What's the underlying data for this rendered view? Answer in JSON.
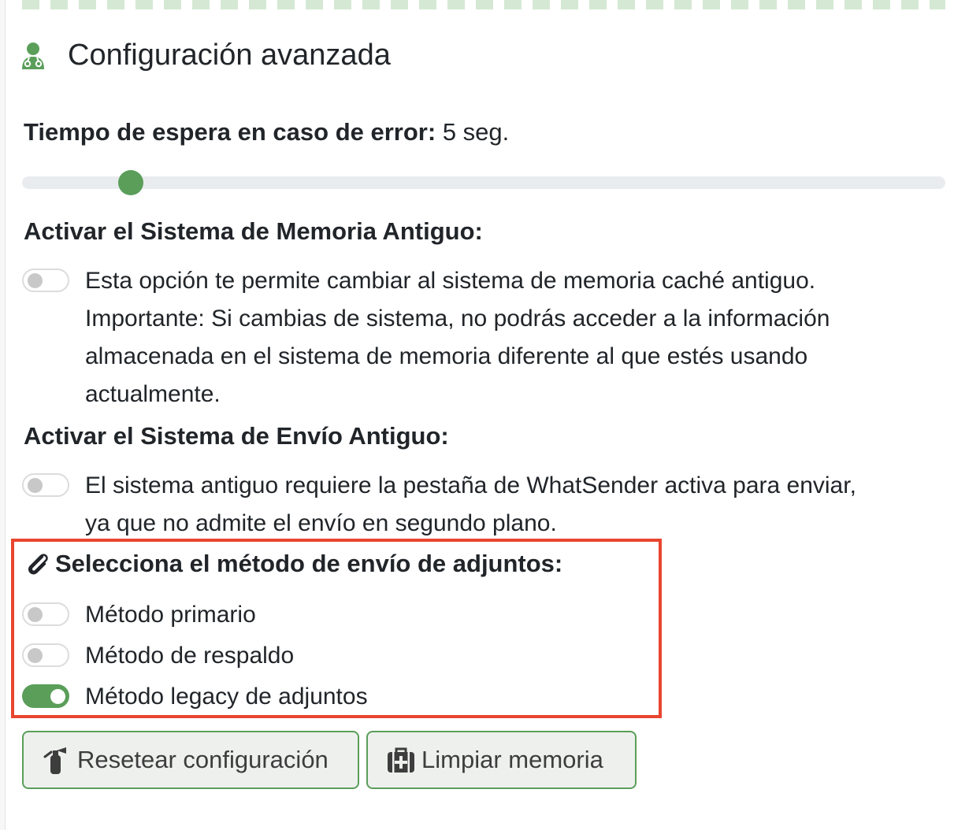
{
  "header": {
    "title": "Configuración avanzada",
    "icon": "user-md-icon"
  },
  "timeout": {
    "label": "Tiempo de espera en caso de error:",
    "value": "5 seg.",
    "slider_fraction": 0.118
  },
  "memory_system": {
    "title": "Activar el Sistema de Memoria Antiguo:",
    "enabled": false,
    "description_lines": [
      "Esta opción te permite cambiar al sistema de memoria caché antiguo.",
      "Importante: Si cambias de sistema, no podrás acceder a la información",
      "almacenada en el sistema de memoria diferente al que estés usando",
      "actualmente."
    ]
  },
  "send_system": {
    "title": "Activar el Sistema de Envío Antiguo:",
    "enabled": false,
    "description_lines": [
      "El sistema antiguo requiere la pestaña de WhatSender activa para enviar,",
      "ya que no admite el envío en segundo plano."
    ]
  },
  "attachments": {
    "title": "Selecciona el método de envío de adjuntos:",
    "icon": "paperclip-icon",
    "options": [
      {
        "label": "Método primario",
        "enabled": false
      },
      {
        "label": "Método de respaldo",
        "enabled": false
      },
      {
        "label": "Método legacy de adjuntos",
        "enabled": true
      }
    ],
    "highlight_color": "#e8452f"
  },
  "buttons": {
    "reset": {
      "label": "Resetear configuración",
      "icon": "fire-extinguisher-icon"
    },
    "clear": {
      "label": "Limpiar memoria",
      "icon": "medkit-icon"
    }
  },
  "colors": {
    "accent": "#5a9e5a",
    "text": "#212529"
  }
}
